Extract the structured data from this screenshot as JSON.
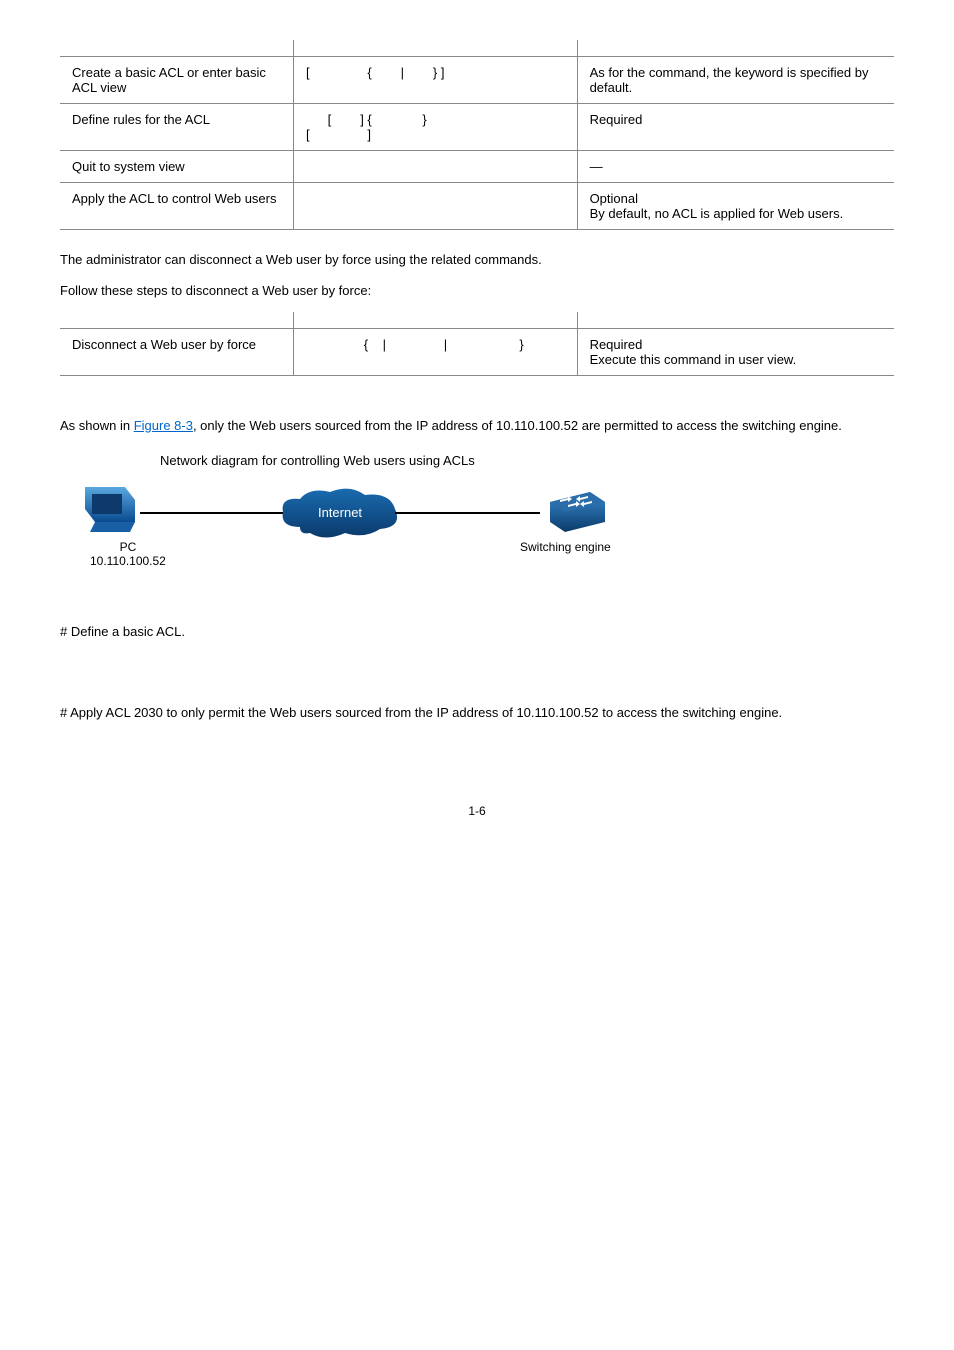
{
  "table1": {
    "rows": [
      {
        "op": "Create a basic ACL or enter basic ACL view",
        "cmd": "[                {        |        } ]",
        "desc_pre": "As for the ",
        "desc_mid": " command, the ",
        "desc_post": " keyword is specified by default."
      },
      {
        "op": "Define rules for the ACL",
        "cmd": "      [        ] {              }\n[                ]",
        "desc": "Required"
      },
      {
        "op": "Quit to system view",
        "cmd": "",
        "desc": "—"
      },
      {
        "op": "Apply the ACL to control Web users",
        "cmd": "",
        "desc1": "Optional",
        "desc2": "By default, no ACL is applied for Web users."
      }
    ]
  },
  "section2": {
    "intro1": "The administrator can disconnect a Web user by force using the related commands.",
    "intro2": "Follow these steps to disconnect a Web user by force:"
  },
  "table2": {
    "row": {
      "op": "Disconnect a Web user by force",
      "cmd": "                {    |                |                    }",
      "desc1": "Required",
      "desc2": "Execute this command in user view."
    }
  },
  "section3": {
    "text_pre": "As shown in ",
    "link": "Figure 8-3",
    "text_post": ", only the Web users sourced from the IP address of 10.110.100.52 are permitted to access the switching engine."
  },
  "figure": {
    "caption": "Network diagram for controlling Web users using ACLs",
    "internet": "Internet",
    "pc": "PC",
    "pc_ip": "10.110.100.52",
    "switch": "Switching engine"
  },
  "step1": "# Define a basic ACL.",
  "step2": "# Apply ACL 2030 to only permit the Web users sourced from the IP address of 10.110.100.52 to access the switching engine.",
  "pagenum": "1-6"
}
